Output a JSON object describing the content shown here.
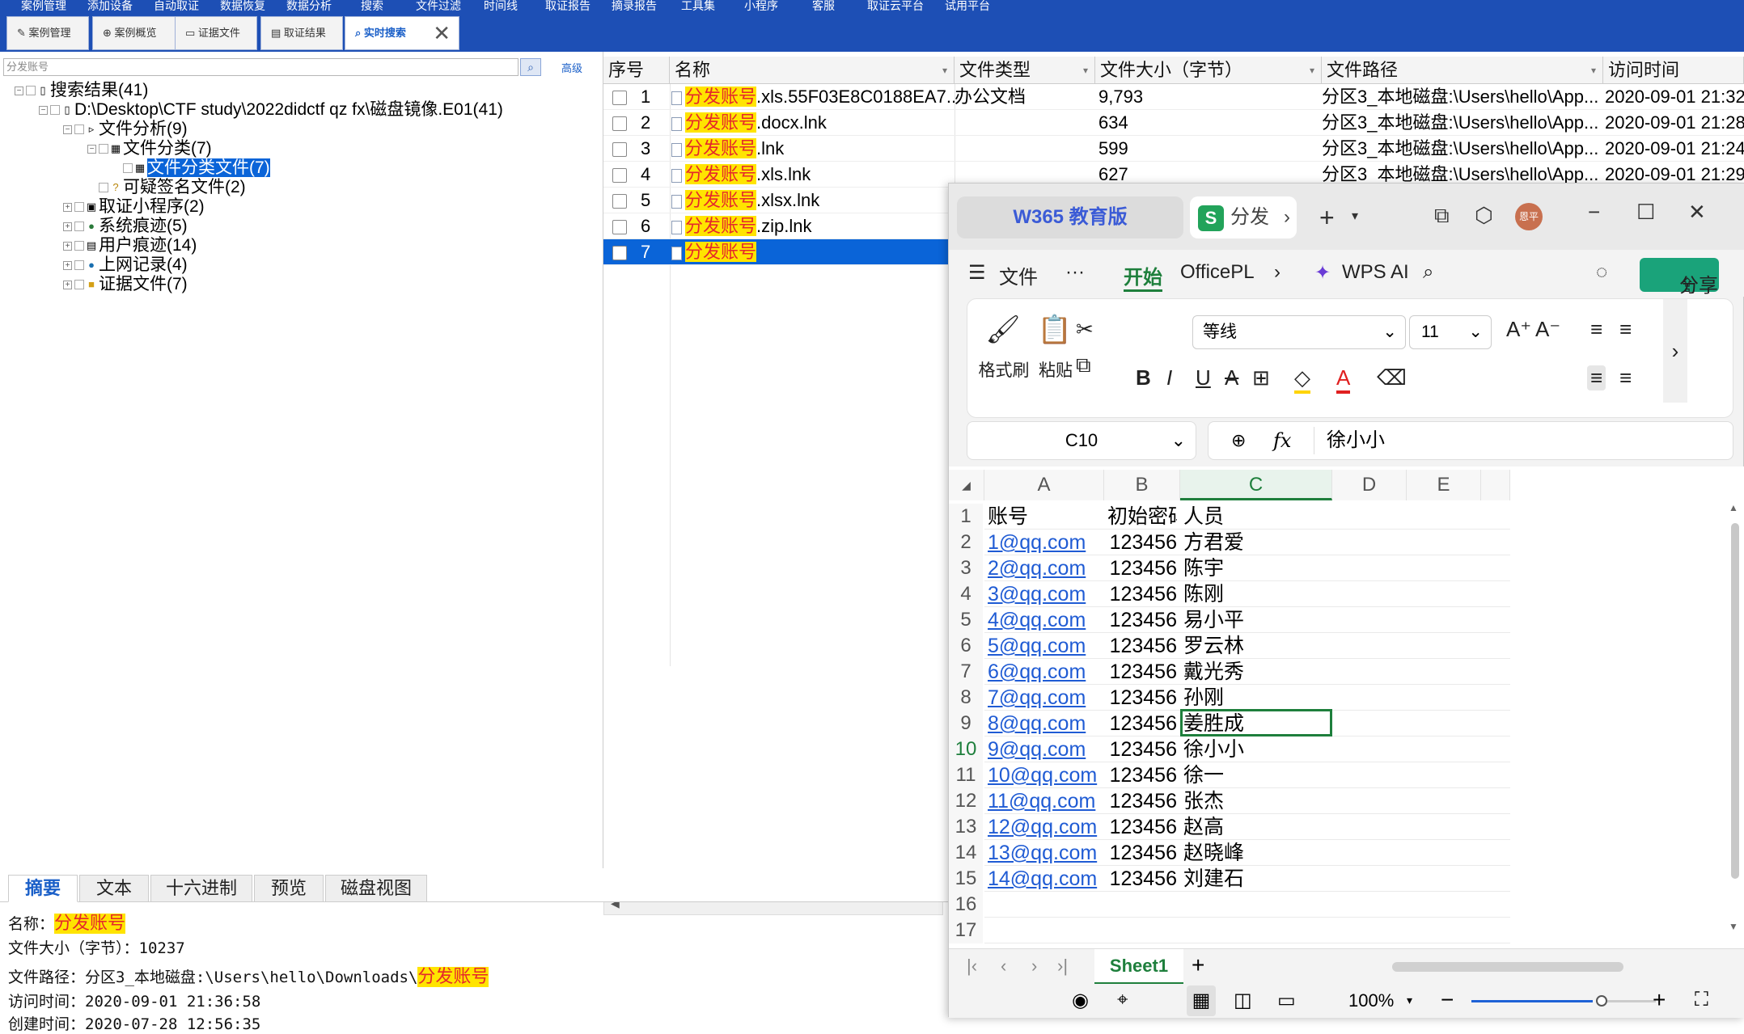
{
  "menu": [
    "案例管理",
    "添加设备",
    "自动取证",
    "数据恢复",
    "数据分析",
    "搜索",
    "文件过滤",
    "时间线",
    "取证报告",
    "摘录报告",
    "工具集",
    "小程序",
    "客服",
    "取证云平台",
    "试用平台"
  ],
  "tabs": [
    {
      "label": "案例管理",
      "icon": "edit-icon"
    },
    {
      "label": "案例概览",
      "icon": "overview-icon"
    },
    {
      "label": "证据文件",
      "icon": "evidence-icon"
    },
    {
      "label": "取证结果",
      "icon": "result-icon"
    },
    {
      "label": "实时搜索",
      "icon": "search-icon",
      "active": true
    }
  ],
  "search": {
    "placeholder": "分发账号",
    "advanced": "高级"
  },
  "tree": [
    {
      "label": "搜索结果(41)"
    },
    {
      "label": "D:\\Desktop\\CTF study\\2022didctf qz fx\\磁盘镜像.E01(41)"
    },
    {
      "label": "文件分析(9)"
    },
    {
      "label": "文件分类(7)"
    },
    {
      "label": "文件分类文件(7)"
    },
    {
      "label": "可疑签名文件(2)"
    },
    {
      "label": "取证小程序(2)"
    },
    {
      "label": "系统痕迹(5)"
    },
    {
      "label": "用户痕迹(14)"
    },
    {
      "label": "上网记录(4)"
    },
    {
      "label": "证据文件(7)"
    }
  ],
  "grid": {
    "headers": [
      "序号",
      "名称",
      "文件类型",
      "文件大小（字节）",
      "文件路径",
      "访问时间"
    ],
    "highlight": "分发账号",
    "rows": [
      {
        "no": "1",
        "suffix": ".xls.55F03E8C0188EA7...",
        "type": "办公文档",
        "size": "9,793",
        "path": "分区3_本地磁盘:\\Users\\hello\\App...",
        "time": "2020-09-01 21:32"
      },
      {
        "no": "2",
        "suffix": ".docx.lnk",
        "type": "",
        "size": "634",
        "path": "分区3_本地磁盘:\\Users\\hello\\App...",
        "time": "2020-09-01 21:28"
      },
      {
        "no": "3",
        "suffix": ".lnk",
        "type": "",
        "size": "599",
        "path": "分区3_本地磁盘:\\Users\\hello\\App...",
        "time": "2020-09-01 21:24"
      },
      {
        "no": "4",
        "suffix": ".xls.lnk",
        "type": "",
        "size": "627",
        "path": "分区3_本地磁盘:\\Users\\hello\\App...",
        "time": "2020-09-01 21:29"
      },
      {
        "no": "5",
        "suffix": ".xlsx.lnk",
        "type": "",
        "size": "",
        "path": "",
        "time": ""
      },
      {
        "no": "6",
        "suffix": ".zip.lnk",
        "type": "",
        "size": "",
        "path": "",
        "time": ""
      },
      {
        "no": "7",
        "suffix": "",
        "type": "",
        "size": "",
        "path": "",
        "time": ""
      }
    ]
  },
  "bottom_tabs": [
    "摘要",
    "文本",
    "十六进制",
    "预览",
    "磁盘视图"
  ],
  "summary": {
    "name_label": "名称：",
    "name_value": "分发账号",
    "size_line": "文件大小（字节）：10237",
    "path_label": "文件路径：分区3_本地磁盘:\\Users\\hello\\Downloads\\",
    "path_value": "分发账号",
    "access": "访问时间：2020-09-01 21:36:58",
    "create": "创建时间：2020-07-28 12:56:35"
  },
  "wps": {
    "brand": "W365 教育版",
    "doc_tab": "分发",
    "menu": {
      "file": "文件",
      "more": "···",
      "start": "开始",
      "officepl": "OfficePL",
      "ai": "WPS AI",
      "share": "分享"
    },
    "avatar": "恩平",
    "ribbon": {
      "format_painter": "格式刷",
      "paste": "粘贴",
      "font": "等线",
      "size": "11"
    },
    "cell_ref": "C10",
    "formula_fx": "fx",
    "formula_value": "徐小小",
    "columns": [
      "A",
      "B",
      "C",
      "D",
      "E"
    ],
    "rows": [
      {
        "n": "1",
        "a": "账号",
        "b": "初始密码",
        "c": "人员",
        "header": true
      },
      {
        "n": "2",
        "a": "1@qq.com",
        "b": "123456",
        "c": "方君爱"
      },
      {
        "n": "3",
        "a": "2@qq.com",
        "b": "123456",
        "c": "陈宇"
      },
      {
        "n": "4",
        "a": "3@qq.com",
        "b": "123456",
        "c": "陈刚"
      },
      {
        "n": "5",
        "a": "4@qq.com",
        "b": "123456",
        "c": "易小平"
      },
      {
        "n": "6",
        "a": "5@qq.com",
        "b": "123456",
        "c": "罗云林"
      },
      {
        "n": "7",
        "a": "6@qq.com",
        "b": "123456",
        "c": "戴光秀"
      },
      {
        "n": "8",
        "a": "7@qq.com",
        "b": "123456",
        "c": "孙刚"
      },
      {
        "n": "9",
        "a": "8@qq.com",
        "b": "123456",
        "c": "姜胜成"
      },
      {
        "n": "10",
        "a": "9@qq.com",
        "b": "123456",
        "c": "徐小小"
      },
      {
        "n": "11",
        "a": "10@qq.com",
        "b": "123456",
        "c": "徐一"
      },
      {
        "n": "12",
        "a": "11@qq.com",
        "b": "123456",
        "c": "张杰"
      },
      {
        "n": "13",
        "a": "12@qq.com",
        "b": "123456",
        "c": "赵高"
      },
      {
        "n": "14",
        "a": "13@qq.com",
        "b": "123456",
        "c": "赵晓峰"
      },
      {
        "n": "15",
        "a": "14@qq.com",
        "b": "123456",
        "c": "刘建石"
      },
      {
        "n": "16",
        "a": "",
        "b": "",
        "c": ""
      },
      {
        "n": "17",
        "a": "",
        "b": "",
        "c": ""
      }
    ],
    "sheet": "Sheet1",
    "zoom": "100%"
  },
  "colors": {
    "menu_bar": "#1d4fb5",
    "highlight": "#ffe400",
    "selection": "#0a64d8",
    "wps_green": "#1e7f3c",
    "share": "#1aa37a"
  }
}
